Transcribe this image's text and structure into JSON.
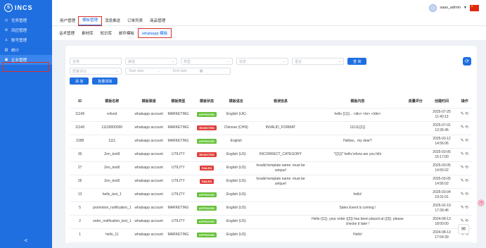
{
  "app": {
    "logo_text": "INCS",
    "logo_mark": "S"
  },
  "sidebar": {
    "items": [
      {
        "label": "任务管理",
        "icon": "clock-icon"
      },
      {
        "label": "风控管理",
        "icon": "gear-icon"
      },
      {
        "label": "账号管理",
        "icon": "user-icon"
      },
      {
        "label": "统计",
        "icon": "chart-icon"
      },
      {
        "label": "企业管理",
        "icon": "building-icon",
        "active": true
      }
    ],
    "collapse_label": "<"
  },
  "topbar": {
    "username": "saas_admin"
  },
  "tabs_main": [
    {
      "label": "用户管理"
    },
    {
      "label": "模板管理",
      "active": true
    },
    {
      "label": "消息推送"
    },
    {
      "label": "订单列表"
    },
    {
      "label": "商品管理"
    }
  ],
  "tabs_sub": [
    {
      "label": "话术管理"
    },
    {
      "label": "素材库"
    },
    {
      "label": "知识库"
    },
    {
      "label": "邮件模板"
    },
    {
      "label": "whatsapp 模板",
      "active": true
    }
  ],
  "filters": {
    "row1": [
      "名称",
      "渠道",
      "类型",
      "状态",
      "语言"
    ],
    "search_label": "查 询",
    "quality_placeholder": "质量评分",
    "start_date": "Start date",
    "date_sep": "→",
    "end_date": "End date",
    "add_label": "添 加",
    "batch_label": "批量添加"
  },
  "table": {
    "columns": [
      "ID",
      "模板名称",
      "模板渠道",
      "模板类型",
      "模板状态",
      "模板语言",
      "错误信息",
      "模板内容",
      "质量评分",
      "创建时间",
      "操作"
    ],
    "rows": [
      {
        "id": "11145",
        "name": "refund",
        "channel": "whatsapp account",
        "type": "MARKETING",
        "status": "APPROVED",
        "lang": "English (UK)",
        "error": "",
        "content": "hello {{1}}... <div> <br> </div>",
        "quality": "",
        "created": "2025-07-25 11:40:13"
      },
      {
        "id": "11140",
        "name": "11100000000",
        "channel": "whatsapp account",
        "type": "MARKETING",
        "status": "REJECTED",
        "lang": "Chinese (CHN)",
        "error": "INVALID_FORMAT",
        "content": "11111{{1}}",
        "quality": "",
        "created": "2025-07-01 12:26:45"
      },
      {
        "id": "3188",
        "name": "1111",
        "channel": "whatsapp account",
        "type": "MARKETING",
        "status": "APPROVED",
        "lang": "English",
        "error": "",
        "content": "Hallow，my dear?",
        "quality": "",
        "created": "2025-03-12 14:56:06"
      },
      {
        "id": "30",
        "name": "Zen_test9",
        "channel": "whatsapp account",
        "type": "UTILITY",
        "status": "REJECTED",
        "lang": "English (US)",
        "error": "INCORRECT_CATEGORY",
        "content": "*{{1}}* hello;\\nhow are you hihi",
        "quality": "",
        "created": "2025-03-05 15:17:00"
      },
      {
        "id": "27",
        "name": "Zen_test6",
        "channel": "whatsapp account",
        "type": "UTILITY",
        "status": "FAILED",
        "lang": "English (US)",
        "error": "Invalid template name: must be unique!",
        "content": "",
        "quality": "",
        "created": "2025-03-05 14:55:02"
      },
      {
        "id": "26",
        "name": "Zen_test5",
        "channel": "whatsapp account",
        "type": "UTILITY",
        "status": "FAILED",
        "lang": "English (US)",
        "error": "Invalid template name: must be unique!",
        "content": "",
        "quality": "",
        "created": "2025-03-05 14:56:02"
      },
      {
        "id": "13",
        "name": "hello_test_1",
        "channel": "whatsapp account",
        "type": "UTILITY",
        "status": "APPROVED",
        "lang": "English (US)",
        "error": "",
        "content": "hello!",
        "quality": "",
        "created": "2025-03-04 19:31:01"
      },
      {
        "id": "5",
        "name": "promotion_notification_1",
        "channel": "whatsapp account",
        "type": "MARKETING",
        "status": "APPROVED",
        "lang": "English (US)",
        "error": "",
        "content": "Sales Event is coming !",
        "quality": "",
        "created": "2025-02-19 17:39:46"
      },
      {
        "id": "2",
        "name": "order_notification_test_1",
        "channel": "whatsapp account",
        "type": "UTILITY",
        "status": "APPROVED",
        "lang": "English (US)",
        "error": "",
        "content": "Hello {{1}}, your order {{2}} has been placed at {{3}}. please checke it later !",
        "quality": "",
        "created": "2024-08-13 18:00:00"
      },
      {
        "id": "1",
        "name": "hello_11",
        "channel": "whatsapp account",
        "type": "MARKETING",
        "status": "APPROVED",
        "lang": "English (US)",
        "error": "",
        "content": "Hello!",
        "quality": "",
        "created": "2024-08-13 17:54:39"
      }
    ]
  },
  "colors": {
    "primary": "#1f6fe0",
    "approved": "#67c23a",
    "rejected": "#e0403b",
    "highlight": "#d9322b"
  }
}
